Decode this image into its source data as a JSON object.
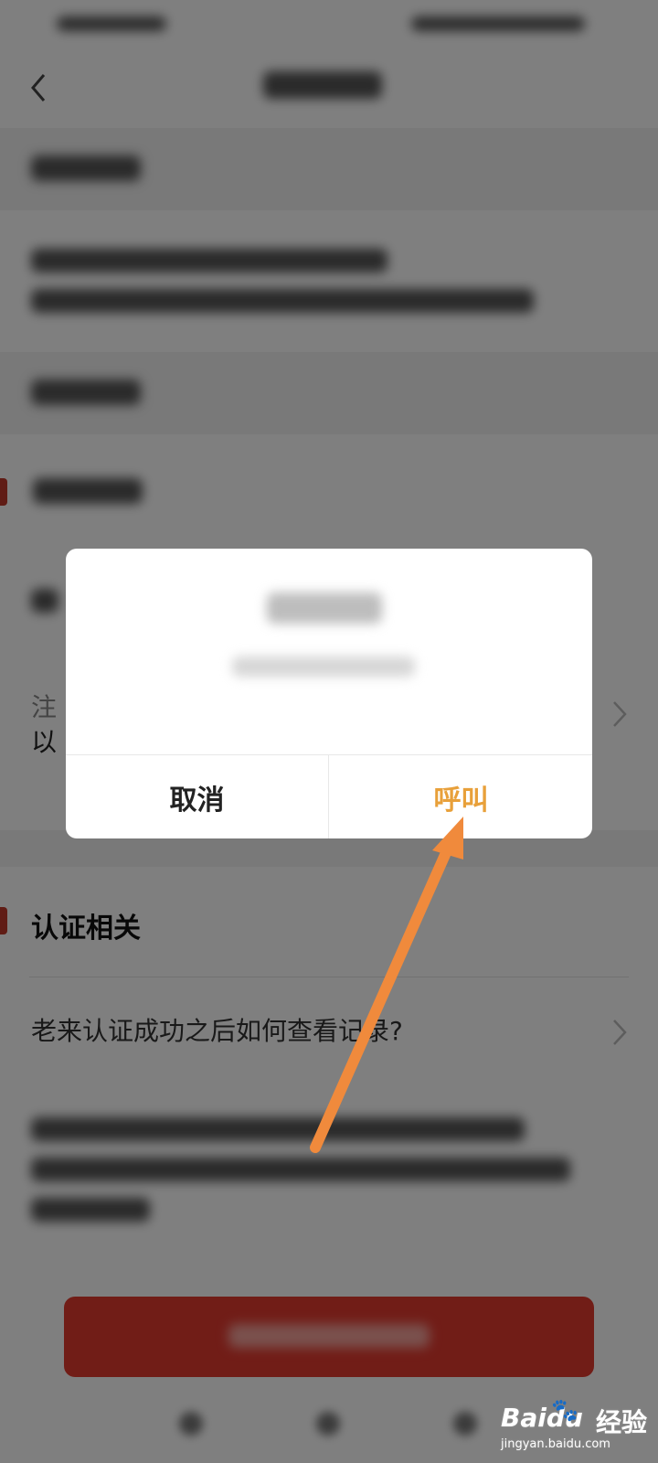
{
  "dialog": {
    "cancel_label": "取消",
    "call_label": "呼叫"
  },
  "sections": {
    "certification_title": "认证相关",
    "faq_question": "老来认证成功之后如何查看记录?",
    "partial_line1": "注",
    "partial_line2": "以"
  },
  "watermark": {
    "brand": "Baidu",
    "paw": "🐾",
    "brand_cn": "经验",
    "sub": "jingyan.baidu.com"
  },
  "colors": {
    "accent_red": "#c0392b",
    "call_orange": "#e8a03a",
    "arrow_orange": "#f08a3c"
  },
  "icons": {
    "back": "chevron-left-icon",
    "chevron": "chevron-right-icon"
  }
}
